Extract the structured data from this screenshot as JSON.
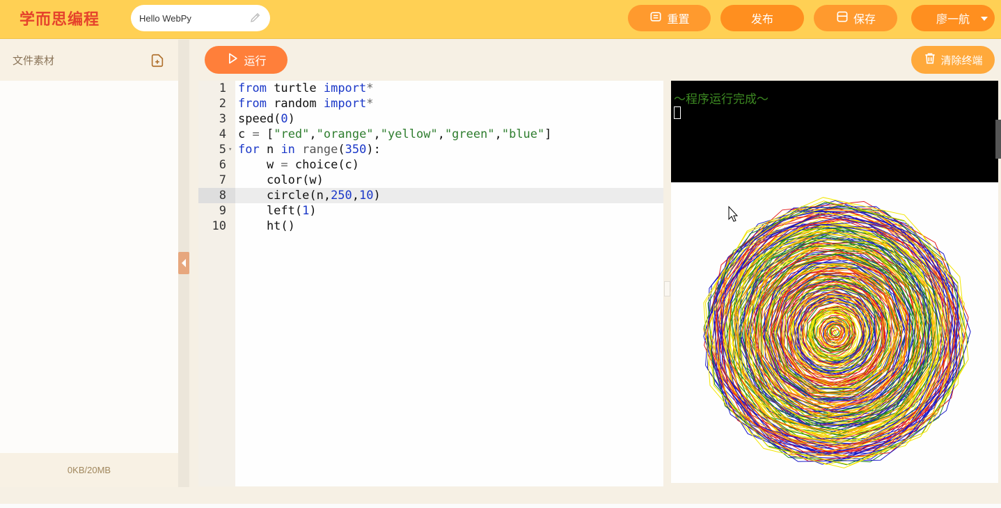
{
  "header": {
    "logo": "学而思编程",
    "project_title": "Hello WebPy",
    "buttons": {
      "reset": "重置",
      "publish": "发布",
      "save": "保存",
      "user": "廖一航"
    }
  },
  "sidebar": {
    "title": "文件素材",
    "storage": "0KB/20MB"
  },
  "toolbar": {
    "run": "运行",
    "clear_terminal": "清除终端"
  },
  "editor": {
    "active_line": 8,
    "lines": [
      {
        "n": "1",
        "code": "from turtle import*"
      },
      {
        "n": "2",
        "code": "from random import*"
      },
      {
        "n": "3",
        "code": "speed(0)"
      },
      {
        "n": "4",
        "code": "c = [\"red\",\"orange\",\"yellow\",\"green\",\"blue\"]"
      },
      {
        "n": "5",
        "code": "for n in range(350):"
      },
      {
        "n": "6",
        "code": "    w = choice(c)"
      },
      {
        "n": "7",
        "code": "    color(w)"
      },
      {
        "n": "8",
        "code": "    circle(n,250,10)"
      },
      {
        "n": "9",
        "code": "    left(1)"
      },
      {
        "n": "10",
        "code": "    ht()"
      }
    ]
  },
  "terminal": {
    "output": "～程序运行完成～"
  },
  "colors": {
    "topbar": "#ffd054",
    "button": "#ff9a2e",
    "turtle_palette": [
      "red",
      "orange",
      "yellow",
      "green",
      "blue"
    ]
  }
}
